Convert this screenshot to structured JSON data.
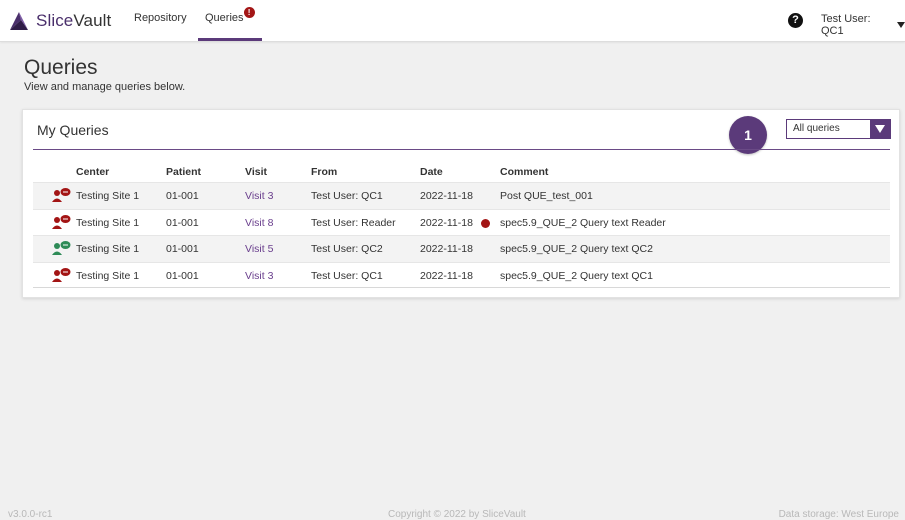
{
  "app": {
    "brand_name_a": "Slice",
    "brand_name_b": "Vault",
    "colors": {
      "accent": "#5b3a7a",
      "alert": "#a31515",
      "ok": "#2e8b57"
    }
  },
  "navbar": {
    "repository_label": "Repository",
    "queries_label": "Queries",
    "queries_badge": "!",
    "help_icon": "question-circle-icon",
    "user_label": "Test User: QC1"
  },
  "page": {
    "title": "Queries",
    "subtitle": "View and manage queries below."
  },
  "card": {
    "title": "My Queries",
    "step_marker": "1",
    "filter": {
      "selected": "All queries"
    }
  },
  "table": {
    "headers": {
      "center": "Center",
      "patient": "Patient",
      "visit": "Visit",
      "from": "From",
      "date": "Date",
      "comment": "Comment"
    },
    "rows": [
      {
        "status": "open",
        "center": "Testing Site 1",
        "patient": "01-001",
        "visit": "Visit 3",
        "from": "Test User: QC1",
        "date": "2022-11-18",
        "unread": false,
        "comment": "Post QUE_test_001"
      },
      {
        "status": "open",
        "center": "Testing Site 1",
        "patient": "01-001",
        "visit": "Visit 8",
        "from": "Test User: Reader",
        "date": "2022-11-18",
        "unread": true,
        "comment": "spec5.9_QUE_2 Query text Reader"
      },
      {
        "status": "resolved",
        "center": "Testing Site 1",
        "patient": "01-001",
        "visit": "Visit 5",
        "from": "Test User: QC2",
        "date": "2022-11-18",
        "unread": false,
        "comment": "spec5.9_QUE_2 Query text QC2"
      },
      {
        "status": "open",
        "center": "Testing Site 1",
        "patient": "01-001",
        "visit": "Visit 3",
        "from": "Test User: QC1",
        "date": "2022-11-18",
        "unread": false,
        "comment": "spec5.9_QUE_2 Query text QC1"
      }
    ]
  },
  "footer": {
    "version": "v3.0.0-rc1",
    "copyright": "Copyright © 2022 by SliceVault",
    "storage": "Data storage: West Europe"
  }
}
